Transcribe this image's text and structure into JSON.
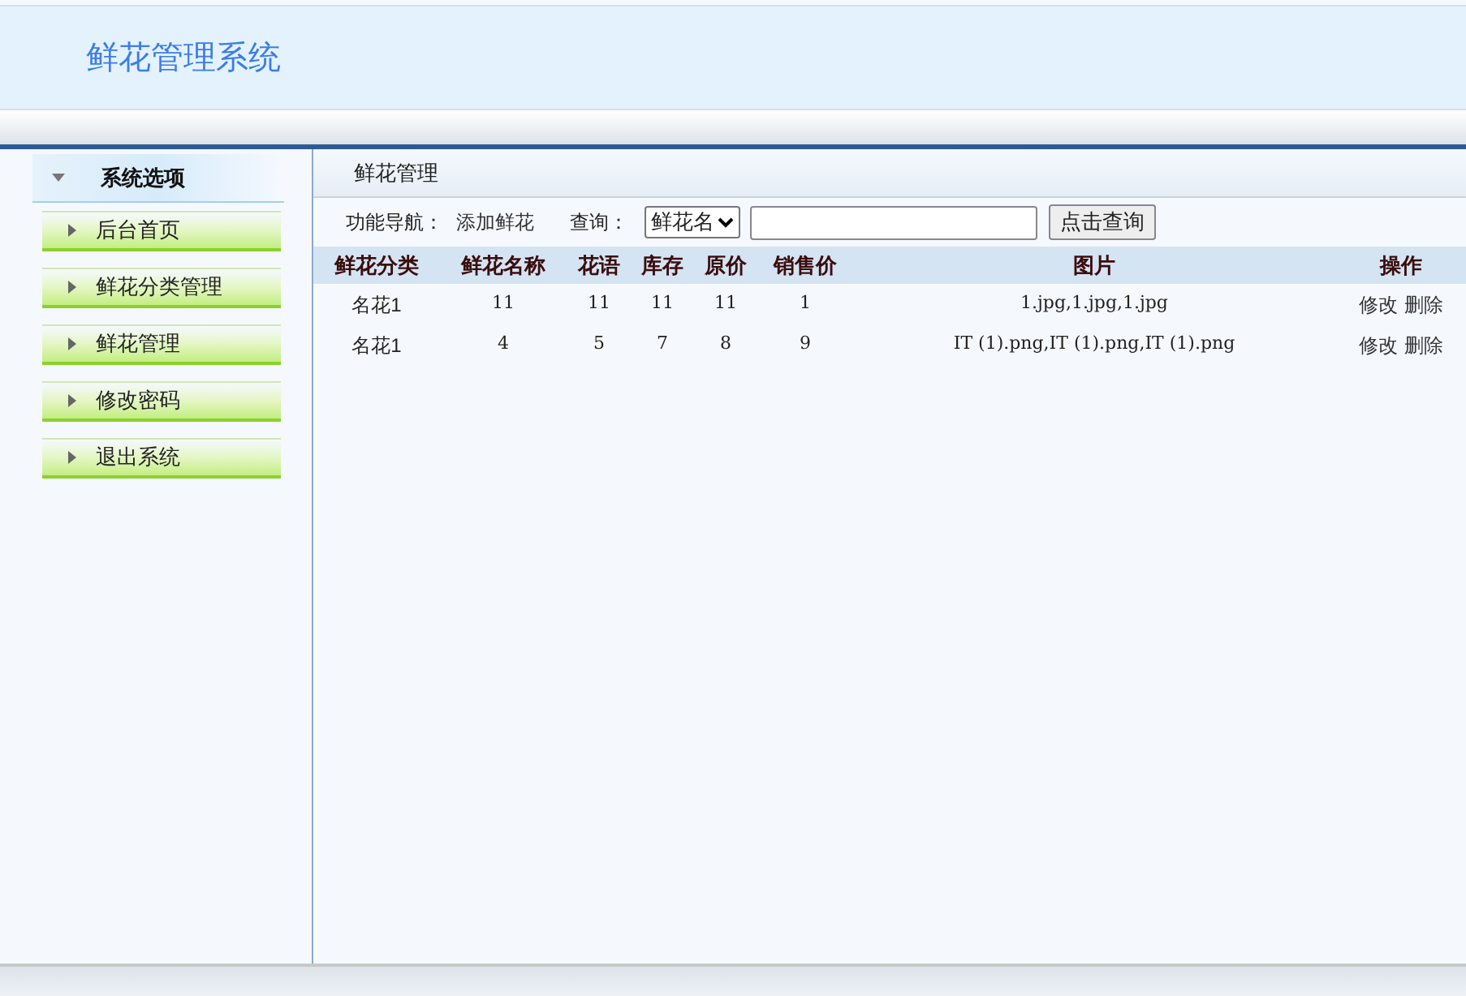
{
  "header": {
    "title": "鲜花管理系统"
  },
  "sidebar": {
    "title": "系统选项",
    "items": [
      {
        "label": "后台首页"
      },
      {
        "label": "鲜花分类管理"
      },
      {
        "label": "鲜花管理"
      },
      {
        "label": "修改密码"
      },
      {
        "label": "退出系统"
      }
    ]
  },
  "content": {
    "title": "鲜花管理",
    "toolbar": {
      "nav_label": "功能导航：",
      "add_link": "添加鲜花",
      "query_label": "查询：",
      "select_value": "鲜花名",
      "search_button": "点击查询"
    },
    "table": {
      "columns": [
        "鲜花分类",
        "鲜花名称",
        "花语",
        "库存",
        "原价",
        "销售价",
        "图片",
        "操作"
      ],
      "rows": [
        {
          "cells": [
            "名花1",
            "11",
            "11",
            "11",
            "11",
            "1",
            "1.jpg,1.jpg,1.jpg"
          ],
          "actions": [
            "修改",
            "删除"
          ]
        },
        {
          "cells": [
            "名花1",
            "4",
            "5",
            "7",
            "8",
            "9",
            "IT (1).png,IT (1).png,IT (1).png"
          ],
          "actions": [
            "修改",
            "删除"
          ]
        }
      ]
    }
  }
}
